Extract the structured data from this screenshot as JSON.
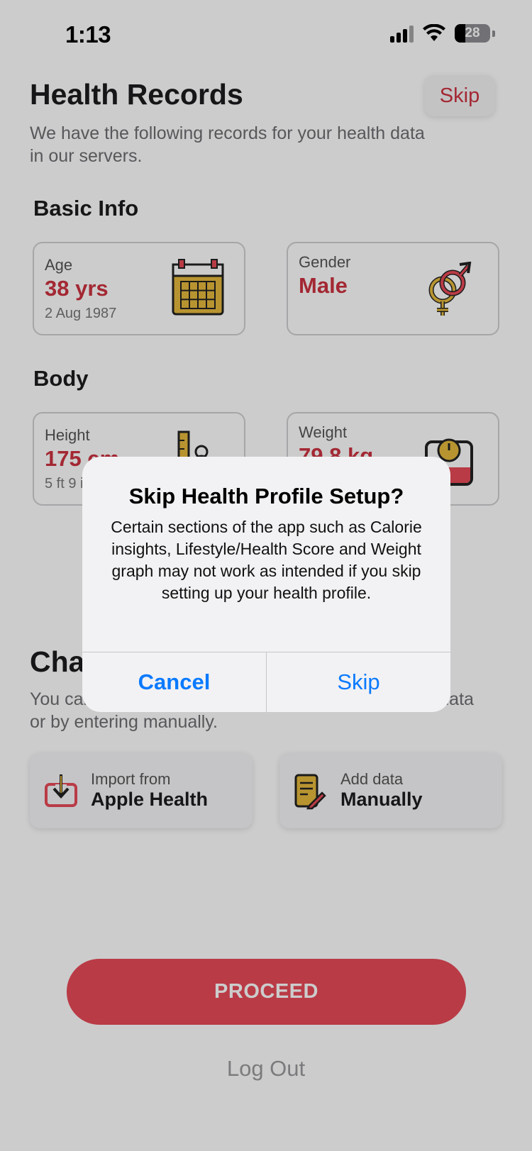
{
  "status_bar": {
    "time": "1:13",
    "battery": "28"
  },
  "header": {
    "title": "Health Records",
    "skip_label": "Skip",
    "subtitle": "We have the following records for your health data in our servers."
  },
  "basic_info": {
    "title": "Basic Info",
    "age": {
      "label": "Age",
      "value": "38 yrs",
      "sub": "2 Aug 1987",
      "icon": "calendar-icon"
    },
    "gender": {
      "label": "Gender",
      "value": "Male",
      "icon": "gender-icon"
    }
  },
  "body": {
    "title": "Body",
    "height": {
      "label": "Height",
      "value": "175 cm",
      "sub": "5 ft 9 in",
      "icon": "ruler-person-icon"
    },
    "weight": {
      "label": "Weight",
      "value": "79.8 kg",
      "icon": "scale-icon"
    }
  },
  "change_section": {
    "title": "Change",
    "subtitle": "You can update your data by importing apple health data or by entering manually.",
    "import": {
      "line1": "Import from",
      "line2": "Apple Health",
      "icon": "import-icon"
    },
    "manual": {
      "line1": "Add data",
      "line2": "Manually",
      "icon": "notepad-pen-icon"
    }
  },
  "proceed_label": "PROCEED",
  "logout_label": "Log Out",
  "alert": {
    "title": "Skip Health Profile Setup?",
    "message": "Certain sections of the app such as Calorie insights, Lifestyle/Health Score and Weight graph may not work as intended if you skip setting up your health profile.",
    "cancel_label": "Cancel",
    "skip_label": "Skip"
  },
  "colors": {
    "accent": "#cc3340",
    "button": "#e84a58",
    "alert_button": "#0a7aff",
    "icon_yellow": "#e7b93e"
  }
}
